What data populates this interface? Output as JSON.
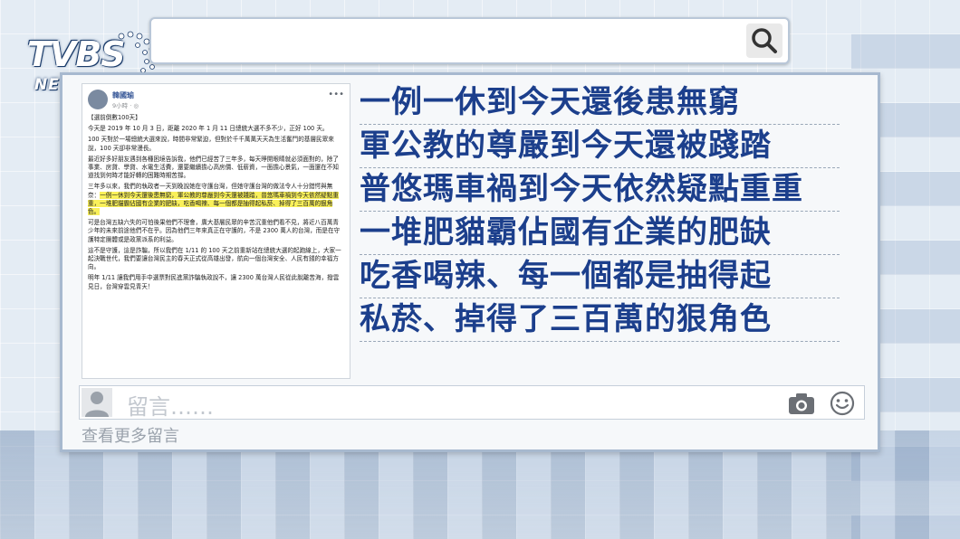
{
  "brand": {
    "name": "TVBS",
    "sub": "NEWS"
  },
  "search": {
    "placeholder": ""
  },
  "post": {
    "author": "韓國瑜",
    "time": "9小時 · ",
    "paragraphs": [
      "【選前倒數100天】",
      "今天是 2019 年 10 月 3 日，距離 2020 年 1 月 11 日總統大選不多不少，正好 100 天。",
      "100 天對於一場總統大選來說，時間非常緊迫，但對於千千萬萬天天為生活奮鬥的基層民眾來說，100 天卻非常漫長。",
      "最近好多好朋友遇到各種困境告訴我，他們已經苦了三年多，每天睜開眼睛就必須面對的，除了事業、房貸、學貸、水電生活費，還要繼續擔心高房價、低薪資，一面擔心景氣，一面還在不知道找到何時才能好轉的困難時期苦撐。",
      "三年多以來，我們的執政者一天到晚說她在守護台灣，但她守護台灣的做法令人十分錯愕與無奈：",
      "一例一休到今天還後患無窮，軍公教的尊嚴到今天還被踐踏，普悠瑪車禍到今天依然疑點重重，一堆肥貓霸佔國有企業的肥缺，吃香喝辣、每一個都是抽得起私菸、掉得了三百萬的狠角色。",
      "可是台灣五缺六失的可怕後果他們不理會，廣大基層民眾的辛苦沉重他們看不見，將近八百萬青少年的未來前途他們不在乎。因為他們三年來真正在守護的，不是 2300 萬人的台灣，而是在守護特定團體或是政黨派系的利益。",
      "這不是守護，這是詐騙，所以我們在 1/11 的 100 天之前重新站在總統大選的起跑線上，大家一起決戰世代，我們要讓台灣民主的春天正式從高雄出發，航向一個台灣安全、人民有錢的幸福方向。",
      "明年 1/11 讓我們用手中選票對民進黨詐騙執政說不，讓 2300 萬台灣人民從此脫離苦海，撥雲見日，台灣穿雲見青天！"
    ]
  },
  "headlines": [
    "一例一休到今天還後患無窮",
    "軍公教的尊嚴到今天還被踐踏",
    "普悠瑪車禍到今天依然疑點重重",
    "一堆肥貓霸佔國有企業的肥缺",
    "吃香喝辣、每一個都是抽得起",
    "私菸、掉得了三百萬的狠角色"
  ],
  "comment": {
    "placeholder": "留言……",
    "more_label": "查看更多留言"
  },
  "colors": {
    "headline": "#1c3f8c",
    "highlight": "#f9f05a"
  }
}
